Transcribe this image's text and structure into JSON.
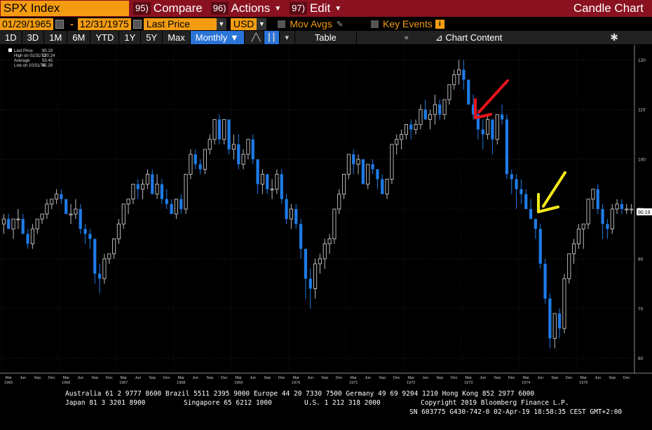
{
  "titlebar": {
    "ticker": "SPX Index",
    "compare_num": "95)",
    "compare_label": "Compare",
    "actions_num": "96)",
    "actions_label": "Actions",
    "edit_num": "97)",
    "edit_label": "Edit",
    "chart_title": "Candle Chart"
  },
  "params": {
    "start_date": "01/29/1965",
    "end_date": "12/31/1975",
    "field": "Last Price",
    "currency": "USD",
    "mov_avgs": "Mov Avgs",
    "key_events": "Key Events"
  },
  "toolbar": {
    "periods": [
      "1D",
      "3D",
      "1M",
      "6M",
      "YTD",
      "1Y",
      "5Y",
      "Max"
    ],
    "frequency": "Monthly",
    "table_label": "Table",
    "chart_content_label": "Chart Content"
  },
  "legend": {
    "last_price": "Last Price",
    "last_price_val": "90.19",
    "high": "High on 01/31/73",
    "high_val": "120.24",
    "average": "Average",
    "average_val": "93.45",
    "low": "Low on 10/31/74",
    "low_val": "62.28"
  },
  "last_tag": "90.19",
  "colors": {
    "up": "#c8c8c8",
    "down": "#1e7be6",
    "accent": "#f39c12",
    "title_bar": "#8a1220"
  },
  "chart_data": {
    "type": "candlestick",
    "ylim": [
      57,
      123
    ],
    "yticks": [
      60,
      70,
      80,
      90,
      100,
      110,
      120
    ],
    "x_month_labels": [
      "Mar",
      "Jun",
      "Sep",
      "Dec",
      "Mar",
      "Jun",
      "Sep",
      "Dec",
      "Mar",
      "Jun",
      "Sep",
      "Dec",
      "Mar",
      "Jun",
      "Sep",
      "Dec",
      "Mar",
      "Jun",
      "Sep",
      "Dec",
      "Mar",
      "Jun",
      "Sep",
      "Dec",
      "Mar",
      "Jun",
      "Sep",
      "Dec",
      "Mar",
      "Jun",
      "Sep",
      "Dec",
      "Mar",
      "Jun",
      "Sep",
      "Dec",
      "Mar",
      "Jun",
      "Sep",
      "Dec",
      "Mar",
      "Jun",
      "Sep",
      "Dec"
    ],
    "x_year_labels": [
      "1965",
      "1966",
      "1967",
      "1968",
      "1969",
      "1970",
      "1971",
      "1972",
      "1973",
      "1974",
      "1975"
    ],
    "candles": [
      [
        87,
        89,
        85,
        88
      ],
      [
        88,
        89,
        86,
        86
      ],
      [
        86,
        88,
        84,
        88
      ],
      [
        88,
        90,
        86,
        88
      ],
      [
        88,
        89,
        85,
        85
      ],
      [
        85,
        86,
        82,
        83
      ],
      [
        83,
        87,
        82,
        86
      ],
      [
        86,
        88,
        85,
        88
      ],
      [
        88,
        89,
        87,
        89
      ],
      [
        89,
        92,
        88,
        91
      ],
      [
        91,
        92,
        90,
        92
      ],
      [
        92,
        94,
        91,
        93
      ],
      [
        93,
        94,
        91,
        92
      ],
      [
        92,
        92,
        89,
        89
      ],
      [
        89,
        91,
        87,
        89
      ],
      [
        89,
        92,
        88,
        90
      ],
      [
        90,
        91,
        85,
        86
      ],
      [
        86,
        87,
        83,
        85
      ],
      [
        85,
        86,
        82,
        84
      ],
      [
        84,
        84,
        75,
        77
      ],
      [
        77,
        79,
        73,
        76
      ],
      [
        76,
        81,
        75,
        80
      ],
      [
        80,
        81,
        79,
        81
      ],
      [
        81,
        84,
        80,
        84
      ],
      [
        84,
        88,
        83,
        87
      ],
      [
        87,
        91,
        86,
        91
      ],
      [
        91,
        92,
        89,
        92
      ],
      [
        92,
        95,
        91,
        95
      ],
      [
        95,
        96,
        92,
        94
      ],
      [
        94,
        96,
        92,
        95
      ],
      [
        95,
        98,
        94,
        97
      ],
      [
        97,
        98,
        94,
        93
      ],
      [
        93,
        97,
        92,
        95
      ],
      [
        95,
        96,
        91,
        92
      ],
      [
        92,
        94,
        90,
        91
      ],
      [
        91,
        92,
        89,
        89
      ],
      [
        89,
        92,
        88,
        92
      ],
      [
        92,
        93,
        89,
        90
      ],
      [
        90,
        97,
        89,
        97
      ],
      [
        97,
        102,
        96,
        101
      ],
      [
        101,
        102,
        98,
        99
      ],
      [
        99,
        100,
        97,
        98
      ],
      [
        98,
        102,
        97,
        102
      ],
      [
        102,
        105,
        101,
        104
      ],
      [
        104,
        108,
        103,
        108
      ],
      [
        108,
        109,
        103,
        104
      ],
      [
        104,
        108,
        103,
        108
      ],
      [
        108,
        108,
        101,
        102
      ],
      [
        102,
        105,
        100,
        103
      ],
      [
        103,
        105,
        98,
        99
      ],
      [
        99,
        102,
        98,
        101
      ],
      [
        101,
        104,
        100,
        104
      ],
      [
        104,
        105,
        99,
        100
      ],
      [
        100,
        100,
        93,
        95
      ],
      [
        95,
        98,
        93,
        97
      ],
      [
        97,
        97,
        93,
        94
      ],
      [
        94,
        96,
        92,
        94
      ],
      [
        94,
        98,
        93,
        97
      ],
      [
        97,
        98,
        91,
        92
      ],
      [
        92,
        93,
        87,
        88
      ],
      [
        88,
        91,
        86,
        90
      ],
      [
        90,
        91,
        86,
        87
      ],
      [
        87,
        88,
        80,
        82
      ],
      [
        82,
        82,
        72,
        76
      ],
      [
        76,
        78,
        70,
        74
      ],
      [
        74,
        80,
        72,
        79
      ],
      [
        79,
        81,
        77,
        80
      ],
      [
        80,
        84,
        78,
        83
      ],
      [
        83,
        85,
        81,
        84
      ],
      [
        84,
        90,
        83,
        90
      ],
      [
        90,
        94,
        89,
        93
      ],
      [
        93,
        97,
        92,
        97
      ],
      [
        97,
        101,
        96,
        101
      ],
      [
        101,
        102,
        97,
        99
      ],
      [
        99,
        101,
        97,
        100
      ],
      [
        100,
        100,
        95,
        95
      ],
      [
        95,
        99,
        94,
        99
      ],
      [
        99,
        100,
        97,
        98
      ],
      [
        98,
        98,
        94,
        96
      ],
      [
        96,
        97,
        93,
        93
      ],
      [
        93,
        96,
        92,
        96
      ],
      [
        96,
        103,
        95,
        103
      ],
      [
        103,
        105,
        101,
        104
      ],
      [
        104,
        106,
        102,
        105
      ],
      [
        105,
        107,
        104,
        107
      ],
      [
        107,
        108,
        104,
        106
      ],
      [
        106,
        108,
        105,
        107
      ],
      [
        107,
        111,
        106,
        110
      ],
      [
        110,
        112,
        108,
        108
      ],
      [
        108,
        110,
        106,
        109
      ],
      [
        109,
        113,
        107,
        111
      ],
      [
        111,
        112,
        108,
        109
      ],
      [
        109,
        112,
        108,
        112
      ],
      [
        112,
        115,
        111,
        115
      ],
      [
        115,
        118,
        114,
        117
      ],
      [
        117,
        120,
        115,
        118
      ],
      [
        118,
        120,
        114,
        116
      ],
      [
        116,
        116,
        111,
        111
      ],
      [
        111,
        113,
        108,
        109
      ],
      [
        109,
        110,
        104,
        106
      ],
      [
        106,
        108,
        102,
        105
      ],
      [
        105,
        109,
        104,
        108
      ],
      [
        108,
        108,
        101,
        104
      ],
      [
        104,
        109,
        103,
        109
      ],
      [
        109,
        111,
        107,
        108
      ],
      [
        108,
        109,
        96,
        97
      ],
      [
        97,
        98,
        93,
        96
      ],
      [
        96,
        97,
        90,
        94
      ],
      [
        94,
        96,
        91,
        93
      ],
      [
        93,
        94,
        90,
        90
      ],
      [
        90,
        92,
        88,
        88
      ],
      [
        88,
        88,
        84,
        86
      ],
      [
        86,
        87,
        78,
        79
      ],
      [
        79,
        80,
        71,
        72
      ],
      [
        72,
        73,
        62,
        64
      ],
      [
        64,
        69,
        62,
        69
      ],
      [
        69,
        70,
        64,
        66
      ],
      [
        66,
        77,
        65,
        76
      ],
      [
        76,
        81,
        75,
        81
      ],
      [
        81,
        84,
        79,
        83
      ],
      [
        83,
        87,
        82,
        86
      ],
      [
        86,
        87,
        82,
        87
      ],
      [
        87,
        92,
        86,
        92
      ],
      [
        92,
        94,
        90,
        94
      ],
      [
        94,
        95,
        89,
        90
      ],
      [
        90,
        91,
        84,
        87
      ],
      [
        87,
        88,
        84,
        86
      ],
      [
        86,
        91,
        85,
        90
      ],
      [
        90,
        92,
        89,
        91
      ],
      [
        91,
        92,
        89,
        90
      ],
      [
        90,
        91,
        89,
        90
      ],
      [
        90,
        91,
        89,
        90
      ]
    ]
  },
  "footer": {
    "line1": "Australia 61 2 9777 8600 Brazil 5511 2395 9000 Europe 44 20 7330 7500 Germany 49 69 9204 1210 Hong Kong 852 2977 6000",
    "line2_a": "Japan 81 3 3201 8900",
    "line2_b": "Singapore 65 6212 1000",
    "line2_c": "U.S. 1 212 318 2000",
    "line2_d": "Copyright 2019 Bloomberg Finance L.P.",
    "line3": "SN 603775 G430-742-0 02-Apr-19 18:58:35 CEST GMT+2:00"
  }
}
